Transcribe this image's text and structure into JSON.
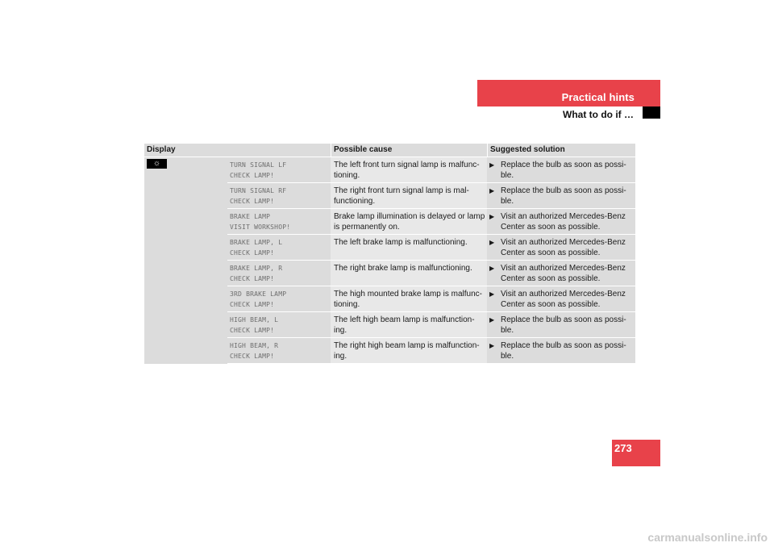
{
  "header": {
    "section_title": "Practical hints",
    "subsection_title": "What to do if …"
  },
  "table": {
    "columns": {
      "display": "Display",
      "cause": "Possible cause",
      "solution": "Suggested solution"
    },
    "display_icon": {
      "name": "lamp-icon",
      "glyph": "☼"
    },
    "bullet_glyph": "▶",
    "rows": [
      {
        "message": "TURN SIGNAL LF\nCHECK LAMP!",
        "cause": "The left front turn signal lamp is malfunc-tioning.",
        "solution": "Replace the bulb as soon as possi-ble."
      },
      {
        "message": "TURN SIGNAL RF\nCHECK LAMP!",
        "cause": "The right front turn signal lamp is mal-functioning.",
        "solution": "Replace the bulb as soon as possi-ble."
      },
      {
        "message": "BRAKE LAMP\nVISIT WORKSHOP!",
        "cause": "Brake lamp illumination is delayed or lamp is permanently on.",
        "solution": "Visit an authorized Mercedes-Benz Center as soon as possible."
      },
      {
        "message": "BRAKE LAMP, L\nCHECK LAMP!",
        "cause": "The left brake lamp is malfunctioning.",
        "solution": "Visit an authorized Mercedes-Benz Center as soon as possible."
      },
      {
        "message": "BRAKE LAMP, R\nCHECK LAMP!",
        "cause": "The right brake lamp is malfunctioning.",
        "solution": "Visit an authorized Mercedes-Benz Center as soon as possible."
      },
      {
        "message": "3RD BRAKE LAMP\nCHECK LAMP!",
        "cause": "The high mounted brake lamp is malfunc-tioning.",
        "solution": "Visit an authorized Mercedes-Benz Center as soon as possible."
      },
      {
        "message": "HIGH BEAM, L\nCHECK LAMP!",
        "cause": "The left high beam lamp is malfunction-ing.",
        "solution": "Replace the bulb as soon as possi-ble."
      },
      {
        "message": "HIGH BEAM, R\nCHECK LAMP!",
        "cause": "The right high beam lamp is malfunction-ing.",
        "solution": "Replace the bulb as soon as possi-ble."
      }
    ]
  },
  "page_number": "273",
  "footer": "carmanualsonline.info",
  "colors": {
    "accent_red": "#e8424a"
  }
}
